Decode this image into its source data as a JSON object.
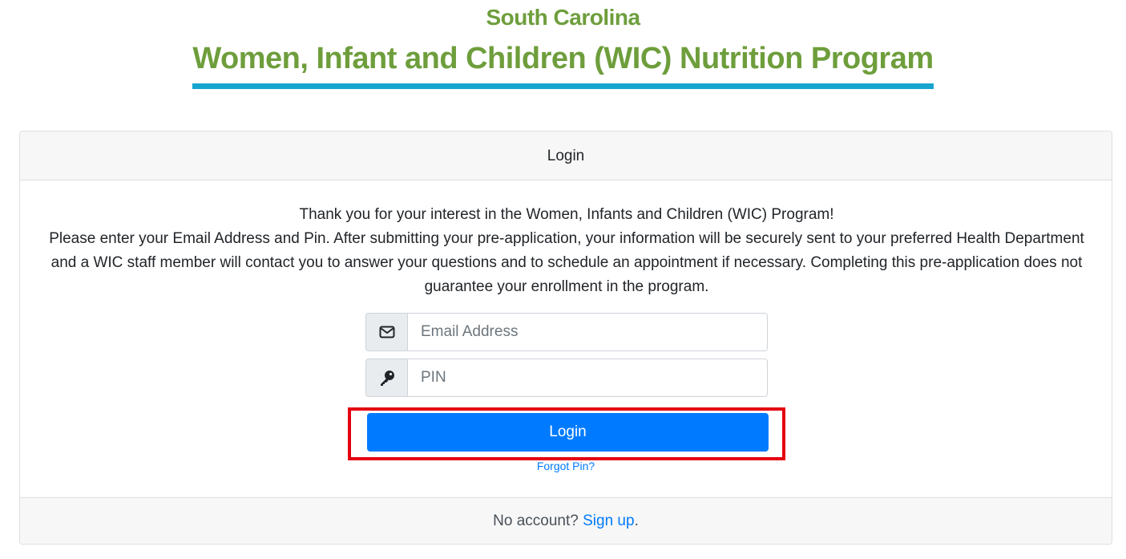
{
  "header": {
    "state": "South Carolina",
    "program_title": "Women, Infant and Children (WIC) Nutrition Program",
    "accent_color": "#6e9e3c",
    "underline_color": "#17a5cf"
  },
  "login_card": {
    "title": "Login",
    "intro_line1": "Thank you for your interest in the Women, Infants and Children (WIC) Program!",
    "intro_line2": "Please enter your Email Address and Pin. After submitting your pre-application, your information will be securely sent to your preferred Health Department and a WIC staff member will contact you to answer your questions and to schedule an appointment if necessary. Completing this pre-application does not guarantee your enrollment in the program.",
    "email": {
      "icon": "envelope-icon",
      "placeholder": "Email Address",
      "value": ""
    },
    "pin": {
      "icon": "key-icon",
      "placeholder": "PIN",
      "value": ""
    },
    "login_button_label": "Login",
    "forgot_pin_label": "Forgot Pin?",
    "footer_text": "No account?",
    "signup_label": "Sign up",
    "footer_suffix": ".",
    "button_color": "#007bff",
    "highlight_color": "#e4000f"
  }
}
